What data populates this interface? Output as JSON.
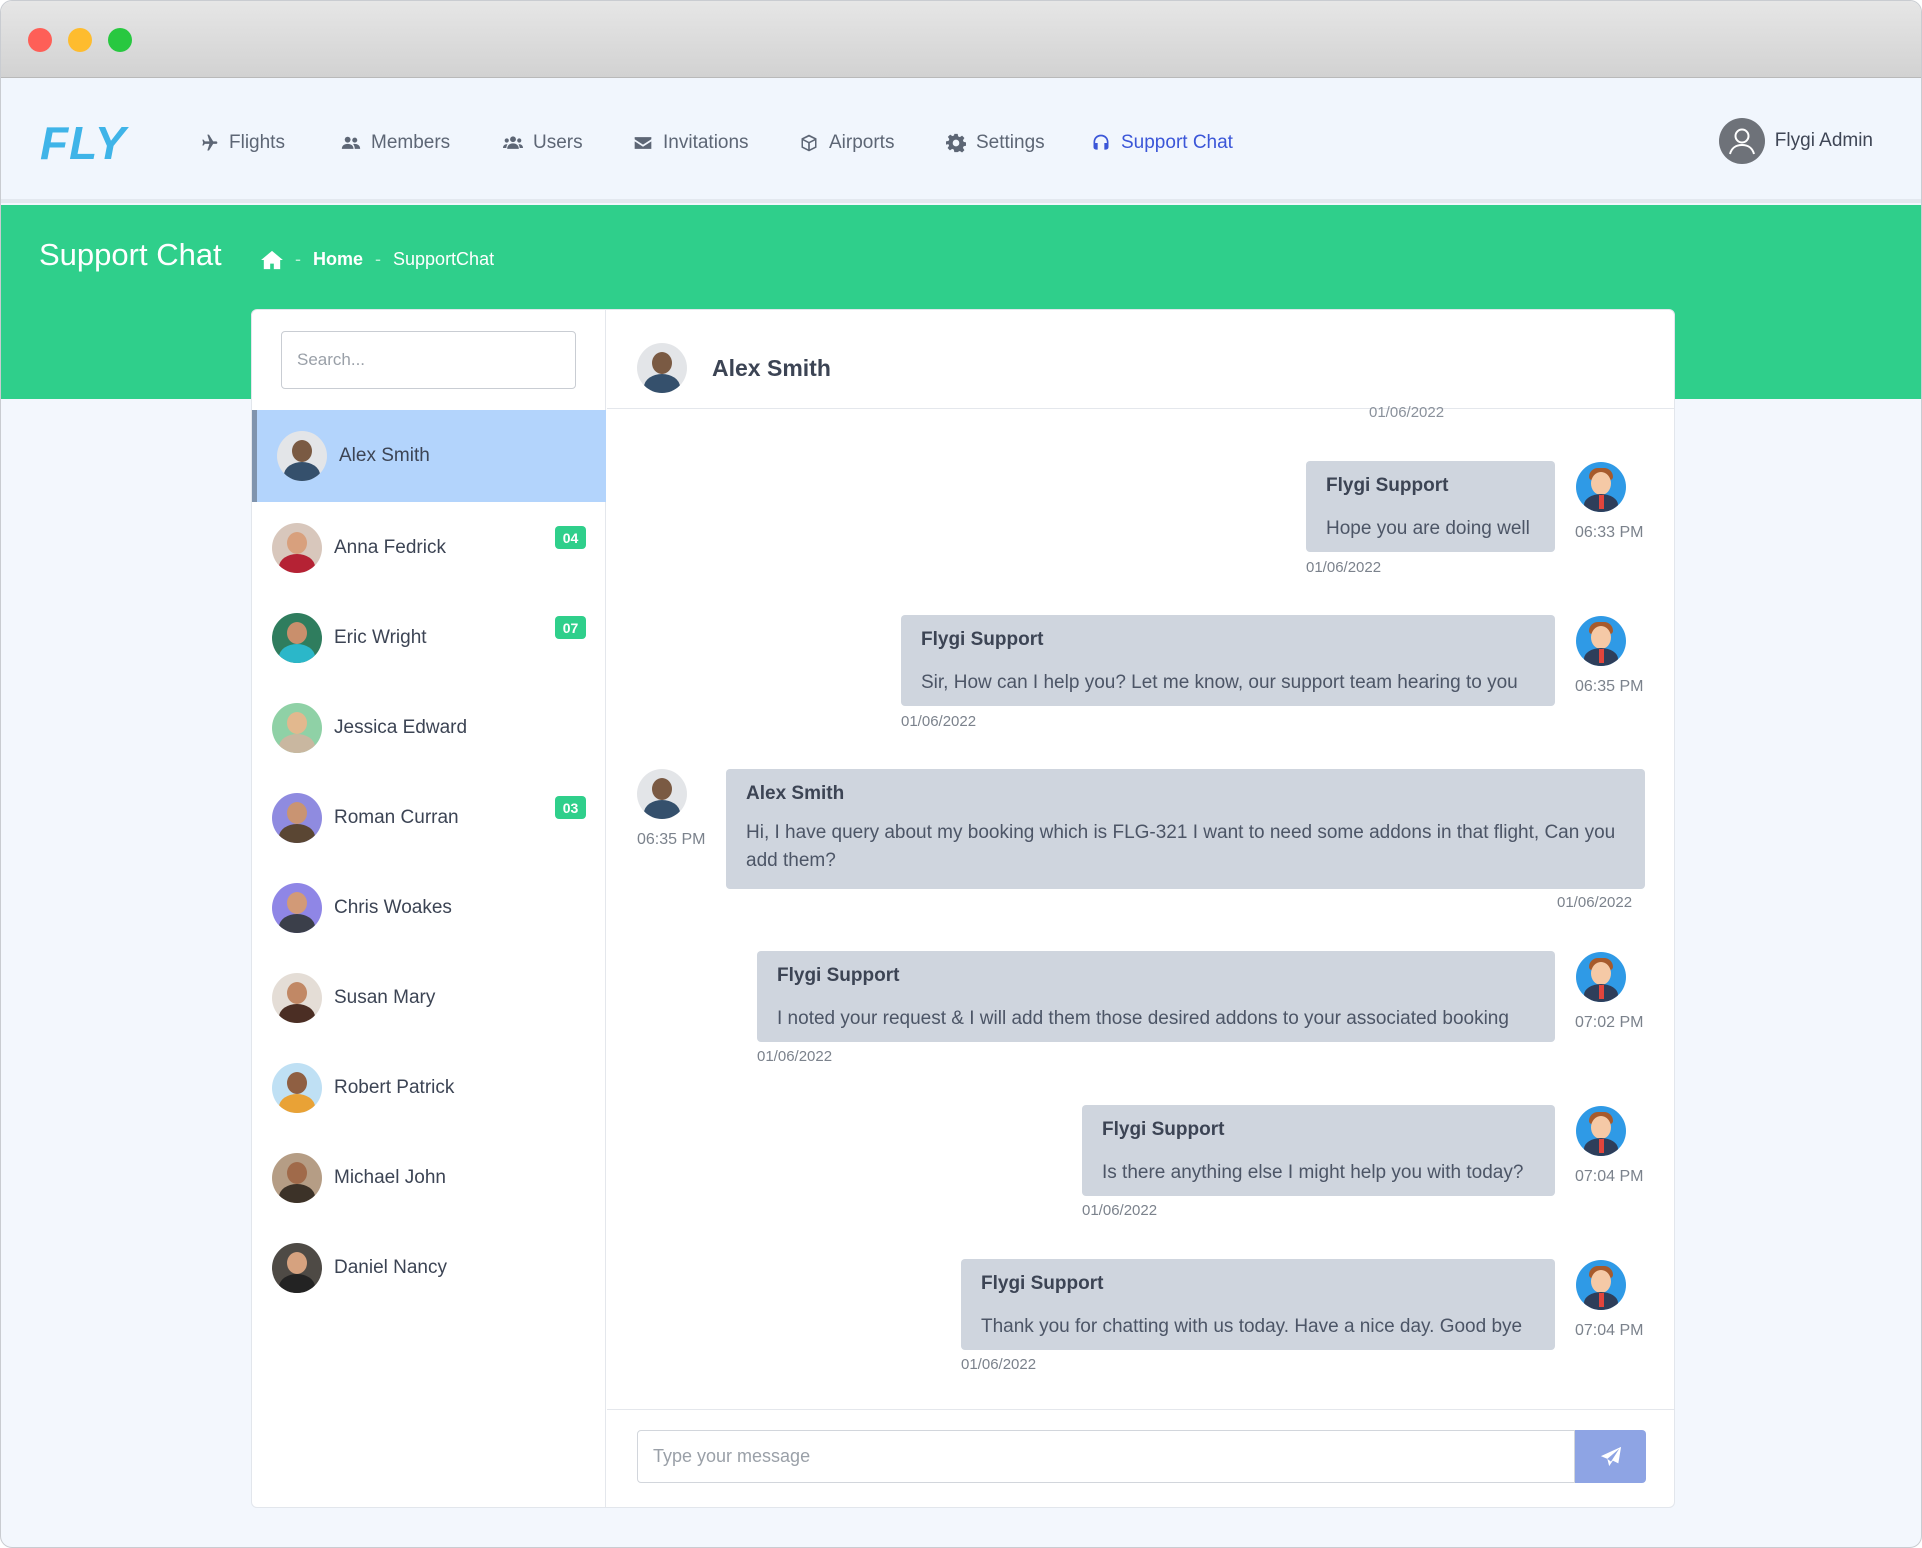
{
  "app": {
    "logo": "FLY"
  },
  "nav": {
    "items": [
      {
        "label": "Flights",
        "icon": "plane-icon"
      },
      {
        "label": "Members",
        "icon": "users-icon"
      },
      {
        "label": "Users",
        "icon": "users-icon"
      },
      {
        "label": "Invitations",
        "icon": "envelope-icon"
      },
      {
        "label": "Airports",
        "icon": "cube-icon"
      },
      {
        "label": "Settings",
        "icon": "gear-icon"
      },
      {
        "label": "Support Chat",
        "icon": "headset-icon",
        "active": true
      }
    ],
    "profile_name": "Flygi Admin"
  },
  "hero": {
    "title": "Support Chat",
    "breadcrumb": {
      "home": "Home",
      "current": "SupportChat"
    }
  },
  "contacts": {
    "search_placeholder": "Search...",
    "list": [
      {
        "name": "Alex Smith",
        "badge": "",
        "active": true
      },
      {
        "name": "Anna Fedrick",
        "badge": "04"
      },
      {
        "name": "Eric Wright",
        "badge": "07"
      },
      {
        "name": "Jessica Edward",
        "badge": ""
      },
      {
        "name": "Roman Curran",
        "badge": "03"
      },
      {
        "name": "Chris Woakes",
        "badge": ""
      },
      {
        "name": "Susan Mary",
        "badge": ""
      },
      {
        "name": "Robert Patrick",
        "badge": ""
      },
      {
        "name": "Michael John",
        "badge": ""
      },
      {
        "name": "Daniel Nancy",
        "badge": ""
      }
    ]
  },
  "conversation": {
    "title": "Alex Smith",
    "scroll_date": "01/06/2022",
    "messages": [
      {
        "sender": "Flygi Support",
        "text": "Hope you are doing well",
        "time": "06:33 PM",
        "date": "01/06/2022",
        "side": "right"
      },
      {
        "sender": "Flygi Support",
        "text": "Sir, How can I help you? Let me know, our support team hearing to you",
        "time": "06:35 PM",
        "date": "01/06/2022",
        "side": "right"
      },
      {
        "sender": "Alex Smith",
        "text": "Hi, I have query about my booking which is FLG-321 I want to need some addons in that flight, Can you add them?",
        "time": "06:35 PM",
        "date": "01/06/2022",
        "side": "left"
      },
      {
        "sender": "Flygi Support",
        "text": "I noted your request & I will add them those desired addons to your associated booking",
        "time": "07:02 PM",
        "date": "01/06/2022",
        "side": "right"
      },
      {
        "sender": "Flygi Support",
        "text": "Is there anything else I might help you with today?",
        "time": "07:04 PM",
        "date": "01/06/2022",
        "side": "right"
      },
      {
        "sender": "Flygi Support",
        "text": "Thank you for chatting with us today. Have a nice day. Good bye",
        "time": "07:04 PM",
        "date": "01/06/2022",
        "side": "right"
      }
    ],
    "composer_placeholder": "Type your message"
  },
  "colors": {
    "accent_green": "#2fcf8b",
    "nav_active": "#3b56d8",
    "bubble": "#cfd5de",
    "send": "#8ea4e4",
    "logo": "#3fb4e8"
  }
}
